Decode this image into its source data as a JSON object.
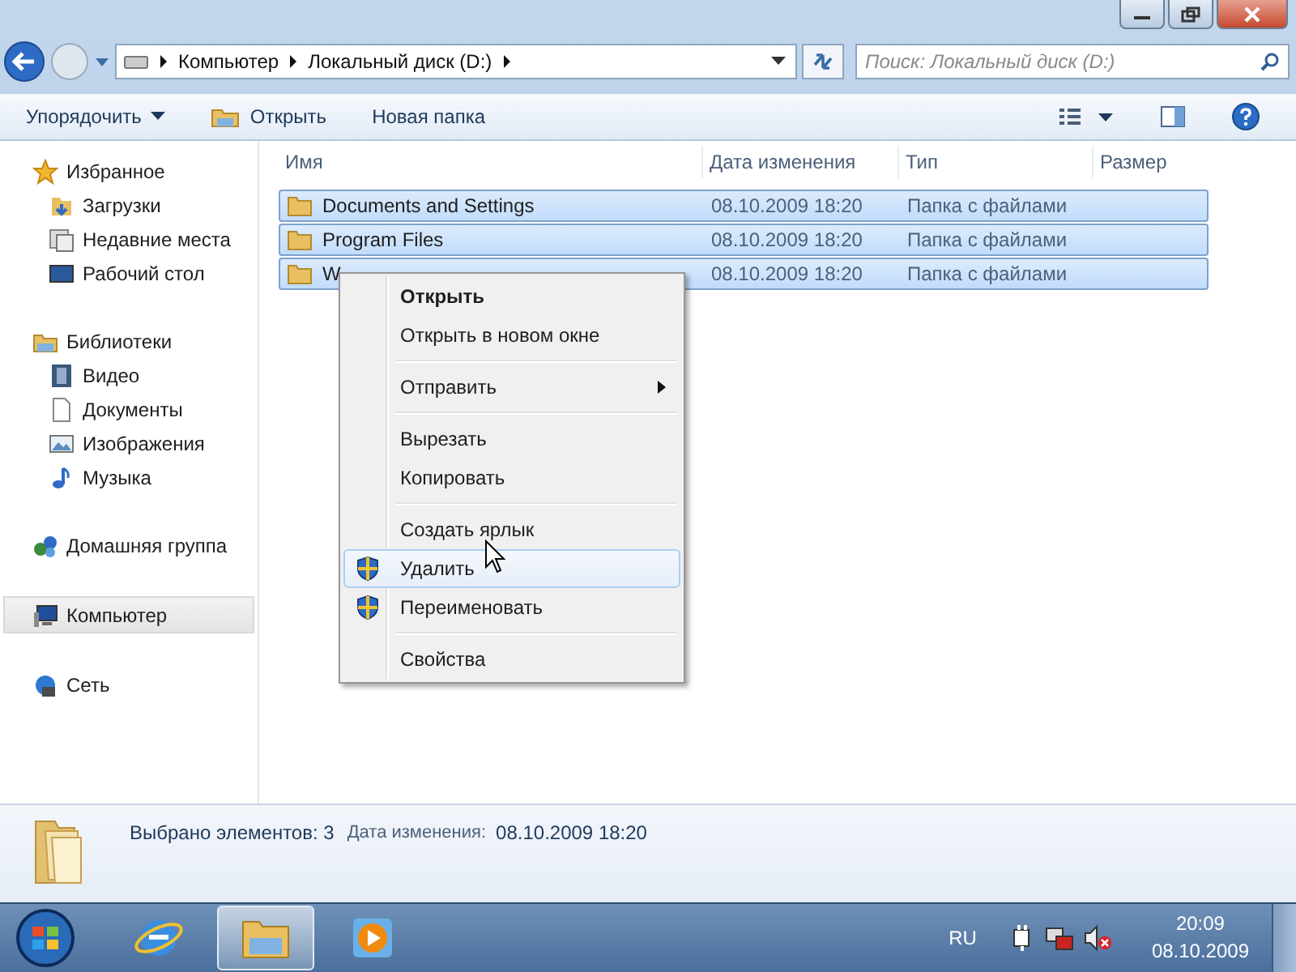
{
  "address_bar": {
    "crumbs": [
      "Компьютер",
      "Локальный диск (D:)"
    ]
  },
  "search": {
    "placeholder": "Поиск: Локальный диск (D:)"
  },
  "toolbar": {
    "buttons": [
      {
        "label": "Упорядочить",
        "kind": "dropdown"
      },
      {
        "label": "Открыть",
        "kind": "icon"
      },
      {
        "label": "Новая папка",
        "kind": "plain"
      }
    ]
  },
  "sidebar": {
    "groups": [
      {
        "label": "Избранное",
        "selected": false,
        "children": [
          {
            "label": "Загрузки"
          },
          {
            "label": "Недавние места"
          },
          {
            "label": "Рабочий стол"
          }
        ]
      },
      {
        "label": "Библиотеки",
        "selected": false,
        "children": [
          {
            "label": "Видео"
          },
          {
            "label": "Документы"
          },
          {
            "label": "Изображения"
          },
          {
            "label": "Музыка"
          }
        ]
      },
      {
        "label": "Домашняя группа",
        "selected": false
      },
      {
        "label": "Компьютер",
        "selected": true
      },
      {
        "label": "Сеть",
        "selected": false
      }
    ]
  },
  "table": {
    "columns": [
      "Имя",
      "Дата изменения",
      "Тип",
      "Размер"
    ],
    "rows": [
      {
        "name": "Documents and Settings",
        "date": "08.10.2009 18:20",
        "type": "Папка с файлами",
        "selected": true
      },
      {
        "name": "Program Files",
        "date": "08.10.2009 18:20",
        "type": "Папка с файлами",
        "selected": true
      },
      {
        "name": "W",
        "date": "08.10.2009 18:20",
        "type": "Папка с файлами",
        "selected": true
      }
    ]
  },
  "context_menu": {
    "groups": [
      [
        {
          "label": "Открыть",
          "default": true,
          "shield": false,
          "submenu": false,
          "selected": false
        },
        {
          "label": "Открыть в новом окне",
          "default": false,
          "shield": false,
          "submenu": false,
          "selected": false
        }
      ],
      [
        {
          "label": "Отправить",
          "default": false,
          "shield": false,
          "submenu": true,
          "selected": false
        }
      ],
      [
        {
          "label": "Вырезать",
          "default": false,
          "shield": false,
          "submenu": false,
          "selected": false
        },
        {
          "label": "Копировать",
          "default": false,
          "shield": false,
          "submenu": false,
          "selected": false
        }
      ],
      [
        {
          "label": "Создать ярлык",
          "default": false,
          "shield": false,
          "submenu": false,
          "selected": false
        },
        {
          "label": "Удалить",
          "default": false,
          "shield": true,
          "submenu": false,
          "selected": true
        },
        {
          "label": "Переименовать",
          "default": false,
          "shield": true,
          "submenu": false,
          "selected": false
        }
      ],
      [
        {
          "label": "Свойства",
          "default": false,
          "shield": false,
          "submenu": false,
          "selected": false
        }
      ]
    ]
  },
  "details_pane": {
    "count": "Выбрано элементов: 3",
    "date_label": "Дата изменения:",
    "date": "08.10.2009 18:20"
  },
  "taskbar": {
    "apps": [
      {
        "selected": false
      },
      {
        "selected": true
      },
      {
        "selected": false
      }
    ],
    "language": "RU",
    "time": "20:09",
    "date": "08.10.2009"
  }
}
